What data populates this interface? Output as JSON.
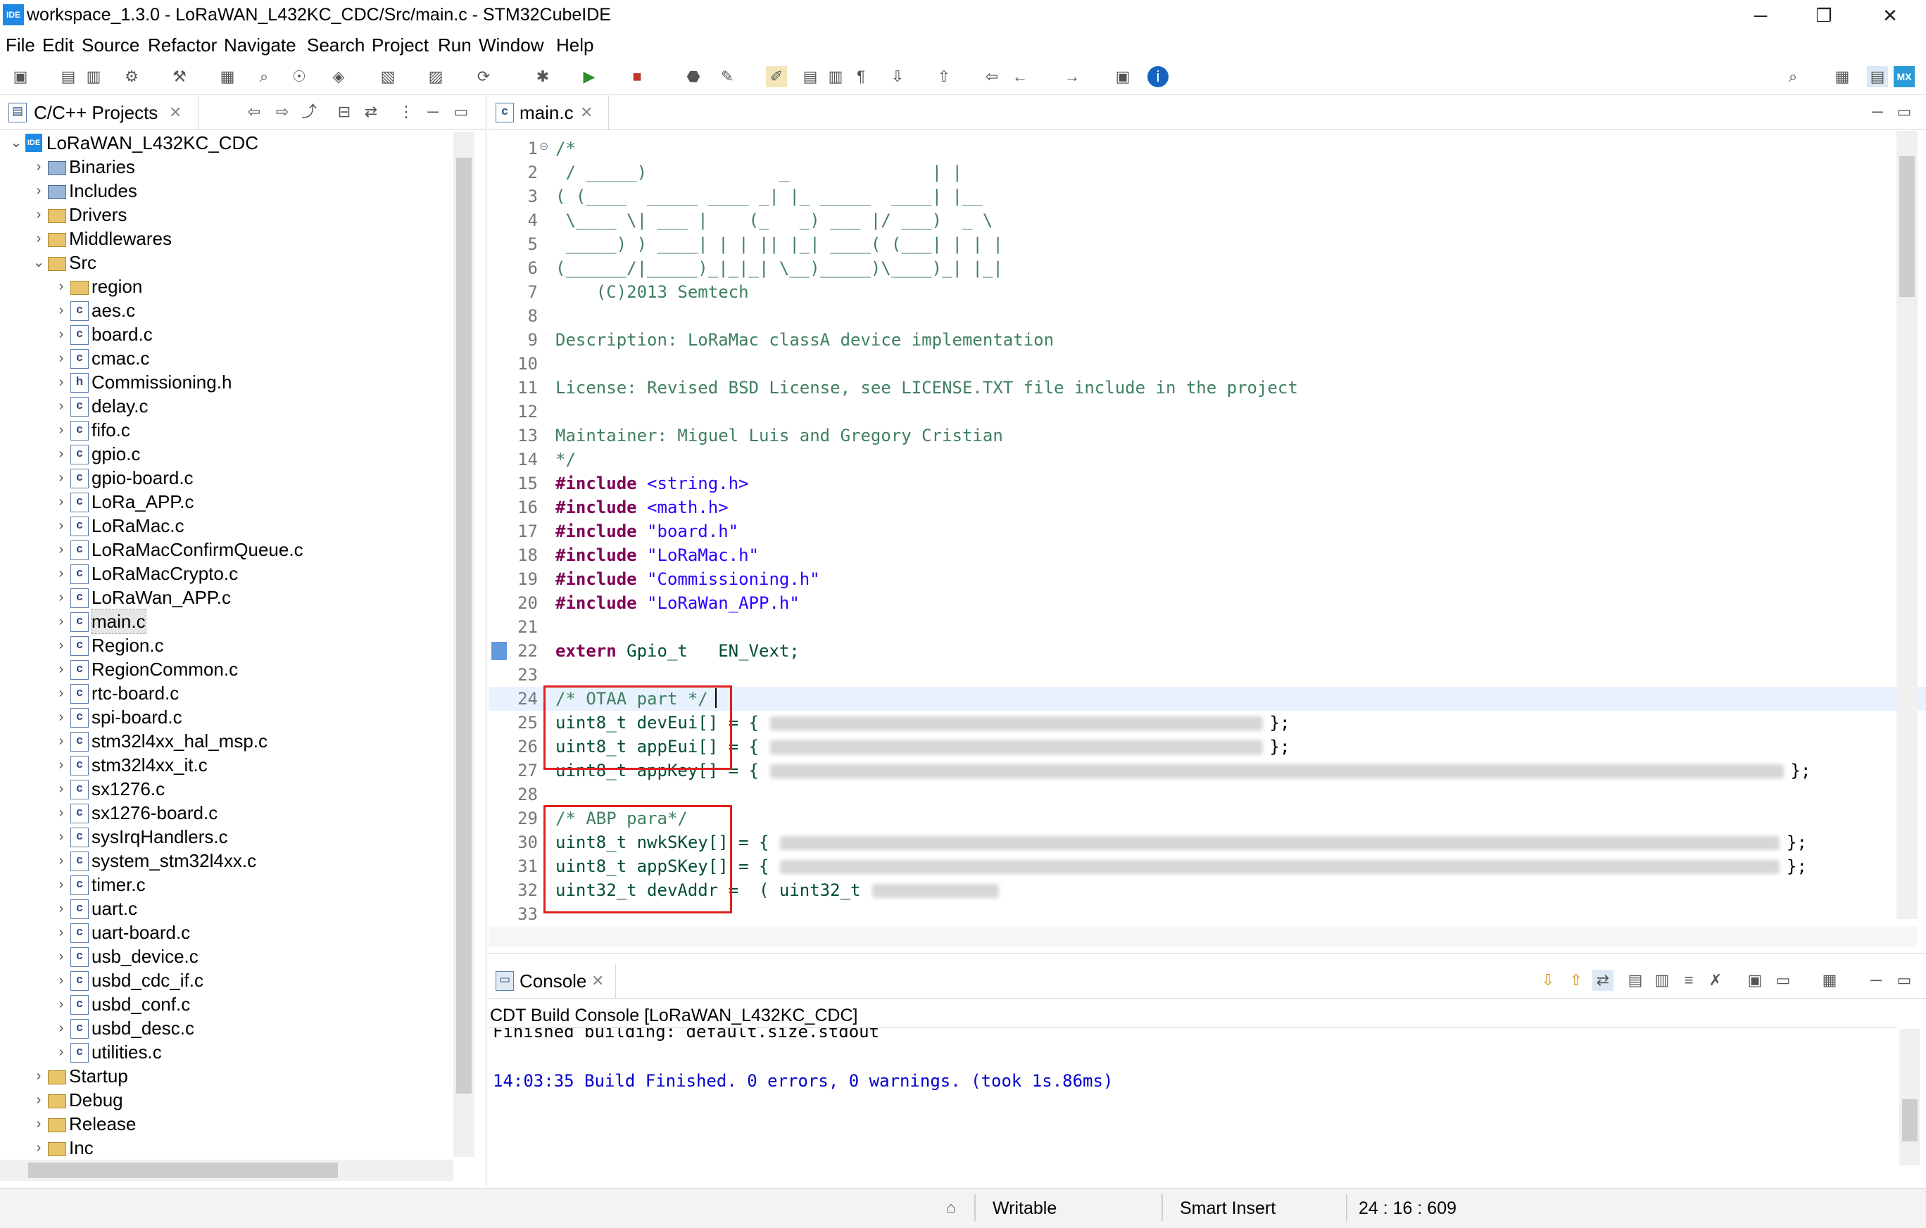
{
  "window": {
    "title": "workspace_1.3.0 - LoRaWAN_L432KC_CDC/Src/main.c - STM32CubeIDE",
    "app_icon": "IDE",
    "minimize": "─",
    "restore": "❐",
    "close": "✕"
  },
  "menu": [
    "File",
    "Edit",
    "Source",
    "Refactor",
    "Navigate",
    "Search",
    "Project",
    "Run",
    "Window",
    "Help"
  ],
  "project_explorer": {
    "title": "C/C++ Projects",
    "close": "✕",
    "root": "LoRaWAN_L432KC_CDC",
    "root_icon": "IDE",
    "top_items": [
      "Binaries",
      "Includes",
      "Drivers",
      "Middlewares",
      "Src"
    ],
    "src_children": [
      "region",
      "aes.c",
      "board.c",
      "cmac.c",
      "Commissioning.h",
      "delay.c",
      "fifo.c",
      "gpio.c",
      "gpio-board.c",
      "LoRa_APP.c",
      "LoRaMac.c",
      "LoRaMacConfirmQueue.c",
      "LoRaMacCrypto.c",
      "LoRaWan_APP.c",
      "main.c",
      "Region.c",
      "RegionCommon.c",
      "rtc-board.c",
      "spi-board.c",
      "stm32l4xx_hal_msp.c",
      "stm32l4xx_it.c",
      "sx1276.c",
      "sx1276-board.c",
      "sysIrqHandlers.c",
      "system_stm32l4xx.c",
      "timer.c",
      "uart.c",
      "uart-board.c",
      "usb_device.c",
      "usbd_cdc_if.c",
      "usbd_conf.c",
      "usbd_desc.c",
      "utilities.c"
    ],
    "bottom_items": [
      "Startup",
      "Debug",
      "Release",
      "Inc"
    ],
    "selected": "main.c",
    "file_icon_c": "c",
    "file_icon_h": "h"
  },
  "editor": {
    "tab_label": "main.c",
    "tab_icon": "c",
    "close": "✕",
    "lines": [
      {
        "n": "1",
        "t": "/*"
      },
      {
        "n": "2",
        "t": " / _____)             _              | |"
      },
      {
        "n": "3",
        "t": "( (____  _____ ____ _| |_ _____  ____| |__"
      },
      {
        "n": "4",
        "t": " \\____ \\| ___ |    (_   _) ___ |/ ___)  _ \\"
      },
      {
        "n": "5",
        "t": " _____) ) ____| | | || |_| ____( (___| | | |"
      },
      {
        "n": "6",
        "t": "(______/|_____)_|_|_| \\__)_____)\\____)_| |_|"
      },
      {
        "n": "7",
        "t": "    (C)2013 Semtech"
      },
      {
        "n": "8",
        "t": ""
      },
      {
        "n": "9",
        "t": "Description: LoRaMac classA device implementation"
      },
      {
        "n": "10",
        "t": ""
      },
      {
        "n": "11",
        "t": "License: Revised BSD License, see LICENSE.TXT file include in the project"
      },
      {
        "n": "12",
        "t": ""
      },
      {
        "n": "13",
        "t": "Maintainer: Miguel Luis and Gregory Cristian"
      },
      {
        "n": "14",
        "t": "*/"
      },
      {
        "n": "15",
        "t": "<string.h>",
        "kw": "#include "
      },
      {
        "n": "16",
        "t": "<math.h>",
        "kw": "#include "
      },
      {
        "n": "17",
        "t": "\"board.h\"",
        "kw": "#include "
      },
      {
        "n": "18",
        "t": "\"LoRaMac.h\"",
        "kw": "#include "
      },
      {
        "n": "19",
        "t": "\"Commissioning.h\"",
        "kw": "#include "
      },
      {
        "n": "20",
        "t": "\"LoRaWan_APP.h\"",
        "kw": "#include "
      },
      {
        "n": "21",
        "t": ""
      },
      {
        "n": "22",
        "t": "Gpio_t   EN_Vext;",
        "kw": "extern "
      },
      {
        "n": "23",
        "t": ""
      },
      {
        "n": "24",
        "t": "/* OTAA part */"
      },
      {
        "n": "25",
        "t": "uint8_t devEui[] = {",
        "end": "};"
      },
      {
        "n": "26",
        "t": "uint8_t appEui[] = {",
        "end": "};"
      },
      {
        "n": "27",
        "t": "uint8_t appKey[] = {",
        "end": "};"
      },
      {
        "n": "28",
        "t": ""
      },
      {
        "n": "29",
        "t": "/* ABP para*/"
      },
      {
        "n": "30",
        "t": "uint8_t nwkSKey[] = {",
        "end": "};"
      },
      {
        "n": "31",
        "t": "uint8_t appSKey[] = {",
        "end": "};"
      },
      {
        "n": "32",
        "t": "uint32_t devAddr =  ( uint32_t"
      },
      {
        "n": "33",
        "t": ""
      }
    ]
  },
  "console": {
    "tab_label": "Console",
    "close": "✕",
    "header": "CDT Build Console [LoRaWAN_L432KC_CDC]",
    "partial_line": "Finished building: default.size.stdout",
    "build_line": "14:03:35 Build Finished. 0 errors, 0 warnings. (took 1s.86ms)"
  },
  "status": {
    "writable": "Writable",
    "insert_mode": "Smart Insert",
    "position": "24 : 16 : 609"
  },
  "colors": {
    "comment": "#3f7f5f",
    "keyword": "#7f0055",
    "string": "#2a00ff",
    "highlight_box": "#e02020",
    "console_text": "#0000cc",
    "selection": "#d9e8fb"
  }
}
